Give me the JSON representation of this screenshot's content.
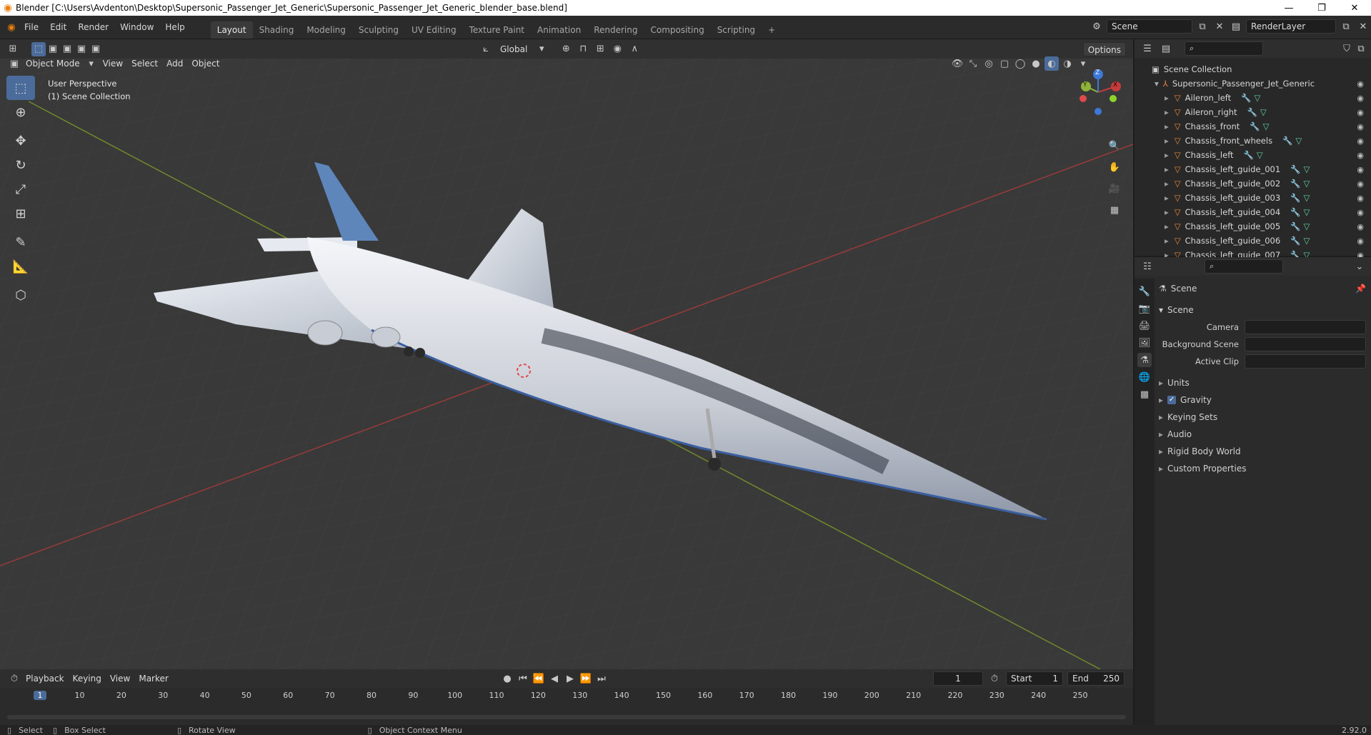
{
  "window": {
    "title": "Blender [C:\\Users\\Avdenton\\Desktop\\Supersonic_Passenger_Jet_Generic\\Supersonic_Passenger_Jet_Generic_blender_base.blend]"
  },
  "menu": [
    "File",
    "Edit",
    "Render",
    "Window",
    "Help"
  ],
  "workspaces": [
    "Layout",
    "Shading",
    "Modeling",
    "Sculpting",
    "UV Editing",
    "Texture Paint",
    "Animation",
    "Rendering",
    "Compositing",
    "Scripting"
  ],
  "active_workspace": "Layout",
  "scene_field": "Scene",
  "renderlayer_field": "RenderLayer",
  "viewport_header": {
    "mode": "Object Mode",
    "menus": [
      "View",
      "Select",
      "Add",
      "Object"
    ],
    "transform_orientation": "Global",
    "options": "Options"
  },
  "viewport": {
    "perspective_label": "User Perspective",
    "collection_label": "(1) Scene Collection",
    "gizmo": {
      "x": "X",
      "y": "Y",
      "z": "Z"
    }
  },
  "outliner": {
    "root": "Scene Collection",
    "collection": "Supersonic_Passenger_Jet_Generic",
    "items": [
      "Aileron_left",
      "Aileron_right",
      "Chassis_front",
      "Chassis_front_wheels",
      "Chassis_left",
      "Chassis_left_guide_001",
      "Chassis_left_guide_002",
      "Chassis_left_guide_003",
      "Chassis_left_guide_004",
      "Chassis_left_guide_005",
      "Chassis_left_guide_006",
      "Chassis_left_guide_007"
    ]
  },
  "properties": {
    "context_title": "Scene",
    "panel_title": "Scene",
    "fields": [
      {
        "label": "Camera",
        "value": ""
      },
      {
        "label": "Background Scene",
        "value": ""
      },
      {
        "label": "Active Clip",
        "value": ""
      }
    ],
    "subpanels": [
      {
        "label": "Units",
        "checkbox": false
      },
      {
        "label": "Gravity",
        "checkbox": true
      },
      {
        "label": "Keying Sets",
        "checkbox": false
      },
      {
        "label": "Audio",
        "checkbox": false
      },
      {
        "label": "Rigid Body World",
        "checkbox": false
      },
      {
        "label": "Custom Properties",
        "checkbox": false
      }
    ]
  },
  "timeline": {
    "menus": [
      "Playback",
      "Keying",
      "View",
      "Marker"
    ],
    "current_frame": "1",
    "start_label": "Start",
    "start": "1",
    "end_label": "End",
    "end": "250",
    "ruler": [
      "1",
      "10",
      "20",
      "30",
      "40",
      "50",
      "60",
      "70",
      "80",
      "90",
      "100",
      "110",
      "120",
      "130",
      "140",
      "150",
      "160",
      "170",
      "180",
      "190",
      "200",
      "210",
      "220",
      "230",
      "240",
      "250"
    ]
  },
  "statusbar": {
    "select": "Select",
    "box_select": "Box Select",
    "rotate": "Rotate View",
    "context_menu": "Object Context Menu",
    "version": "2.92.0"
  },
  "colors": {
    "accent": "#4b6c9a",
    "object_icon": "#e8873a",
    "modifier_icon": "#6fa4e0",
    "mesh_icon": "#5fd3a6",
    "x_axis": "#c43c3c",
    "y_axis": "#8fb33a"
  }
}
